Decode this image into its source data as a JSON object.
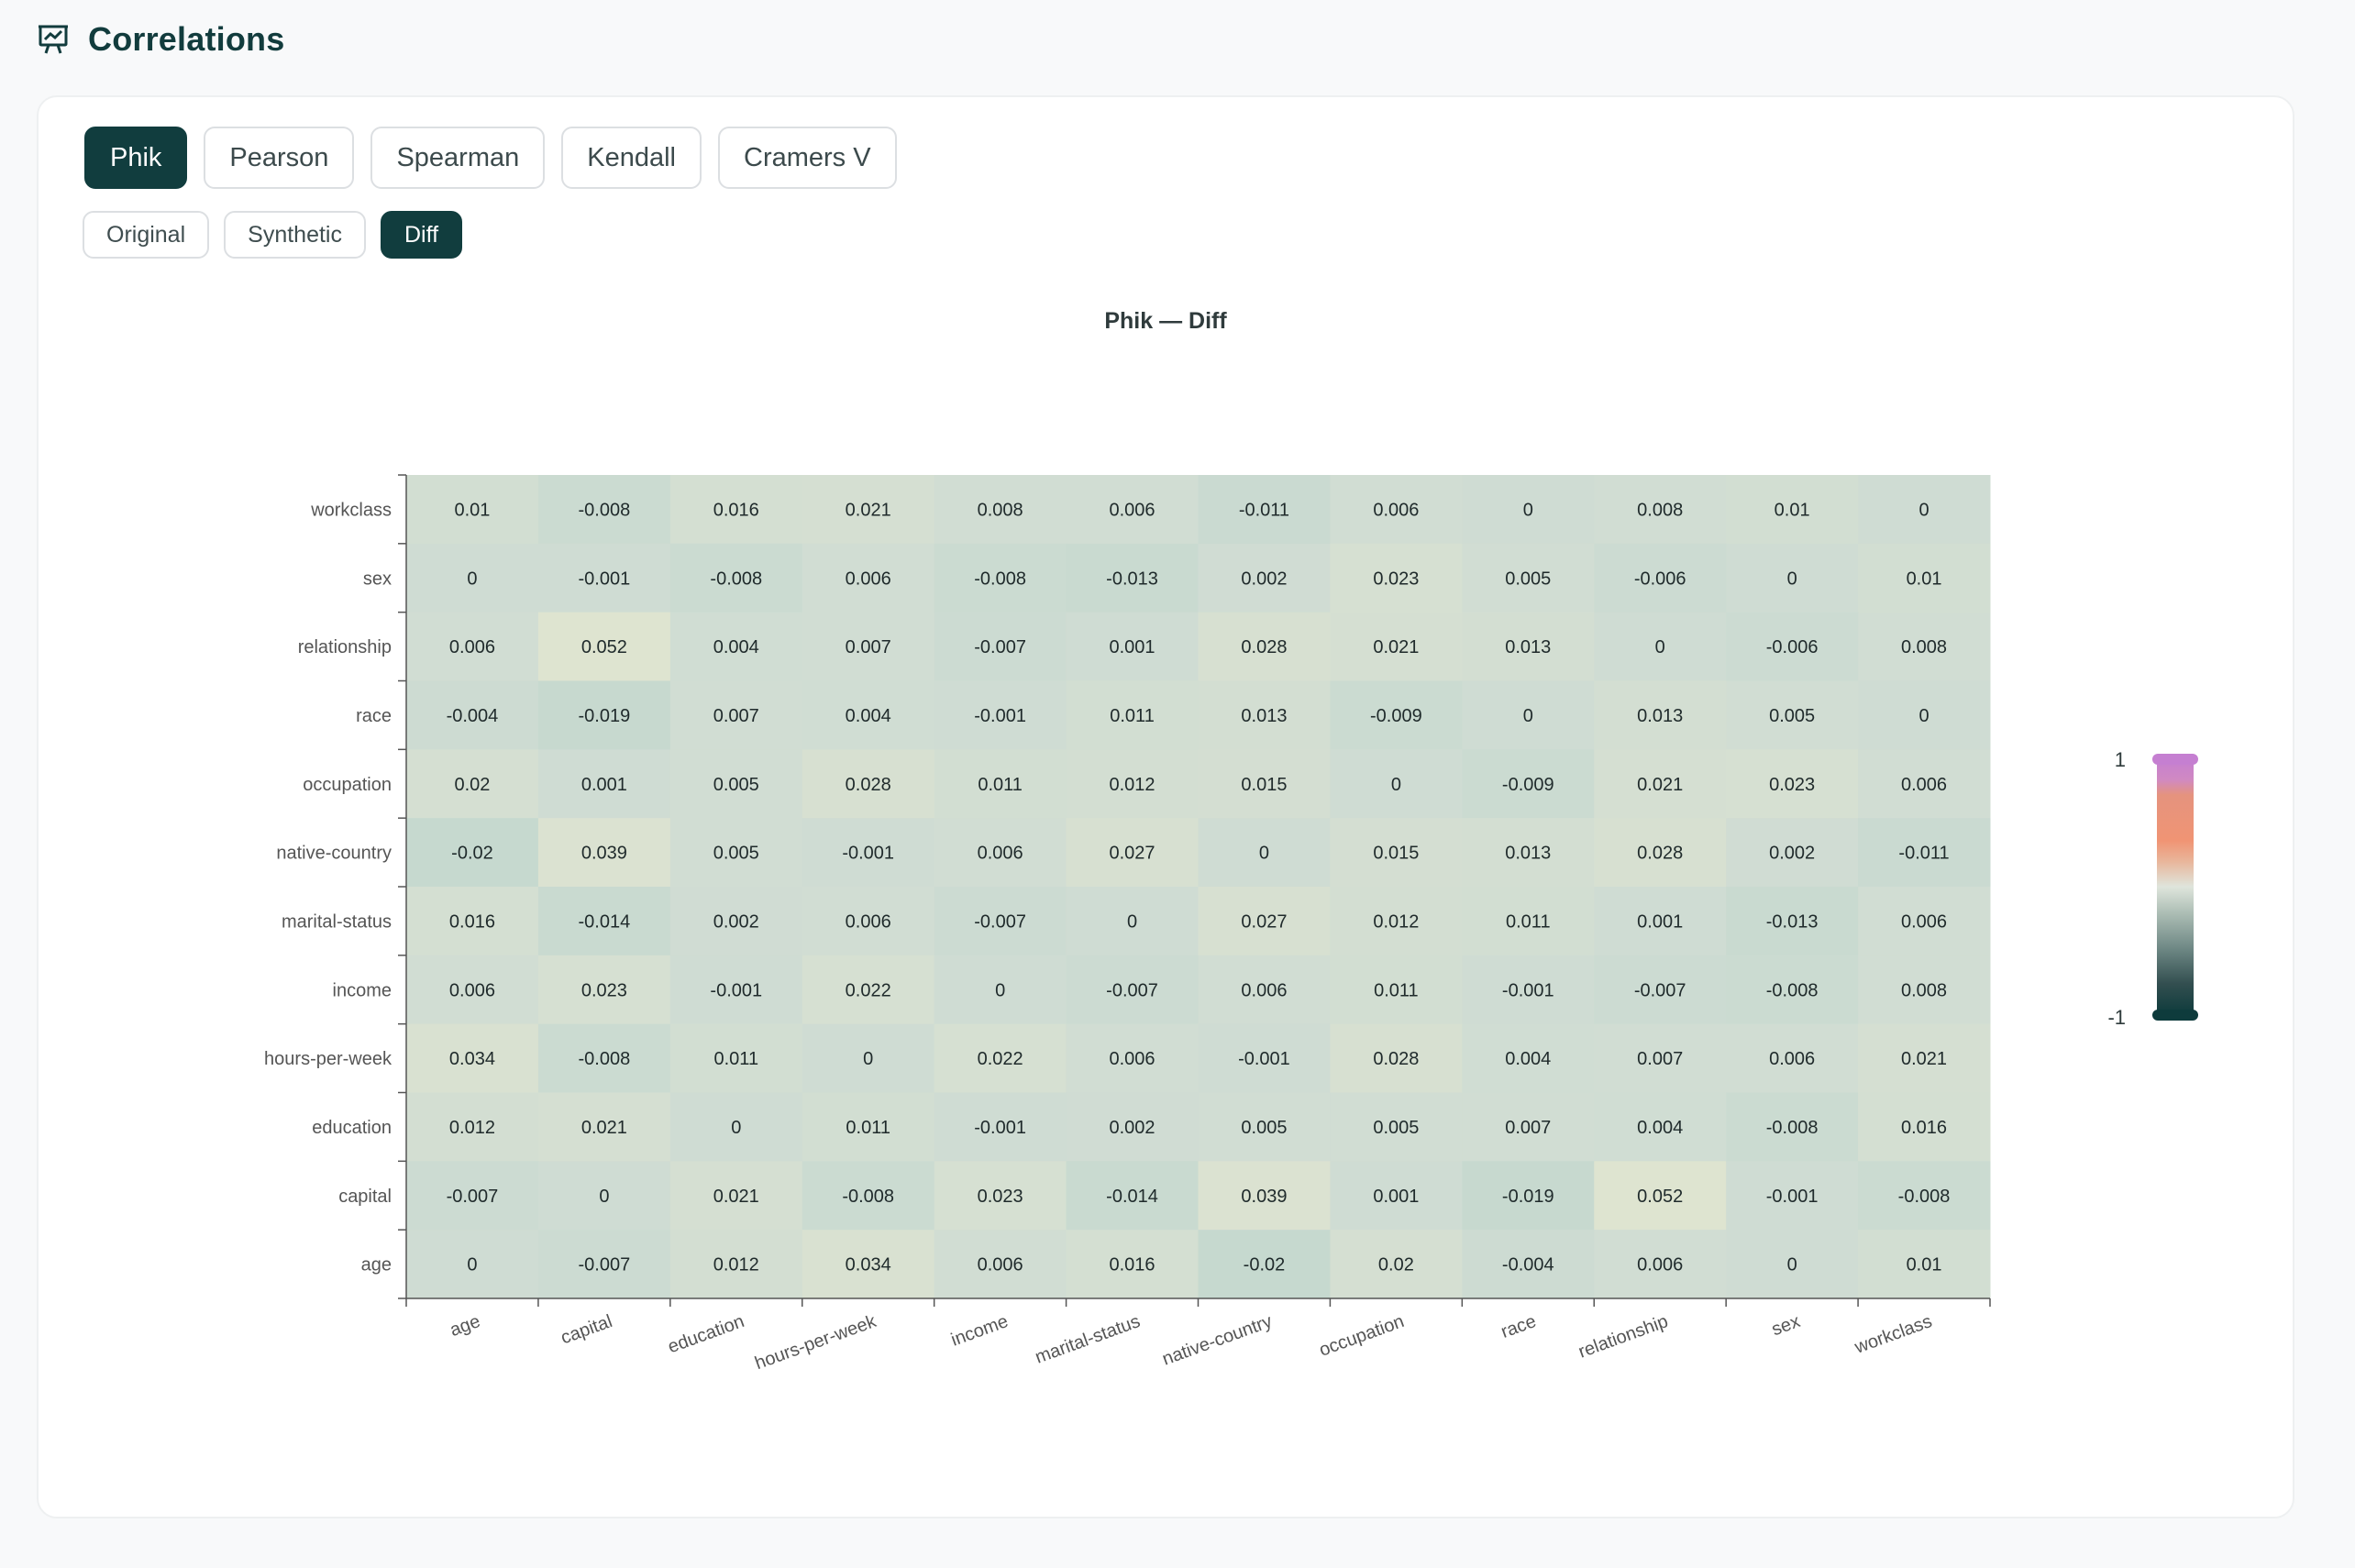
{
  "page": {
    "title": "Correlations"
  },
  "tabs": [
    {
      "label": "Phik",
      "active": true
    },
    {
      "label": "Pearson",
      "active": false
    },
    {
      "label": "Spearman",
      "active": false
    },
    {
      "label": "Kendall",
      "active": false
    },
    {
      "label": "Cramers V",
      "active": false
    }
  ],
  "subtabs": [
    {
      "label": "Original",
      "active": false
    },
    {
      "label": "Synthetic",
      "active": false
    },
    {
      "label": "Diff",
      "active": true
    }
  ],
  "chart_data": {
    "type": "heatmap",
    "title": "Phik — Diff",
    "x": [
      "age",
      "capital",
      "education",
      "hours-per-week",
      "income",
      "marital-status",
      "native-country",
      "occupation",
      "race",
      "relationship",
      "sex",
      "workclass"
    ],
    "y": [
      "workclass",
      "sex",
      "relationship",
      "race",
      "occupation",
      "native-country",
      "marital-status",
      "income",
      "hours-per-week",
      "education",
      "capital",
      "age"
    ],
    "values": [
      [
        "0.01",
        "-0.008",
        "0.016",
        "0.021",
        "0.008",
        "0.006",
        "-0.011",
        "0.006",
        "0",
        "0.008",
        "0.01",
        "0"
      ],
      [
        "0",
        "-0.001",
        "-0.008",
        "0.006",
        "-0.008",
        "-0.013",
        "0.002",
        "0.023",
        "0.005",
        "-0.006",
        "0",
        "0.01"
      ],
      [
        "0.006",
        "0.052",
        "0.004",
        "0.007",
        "-0.007",
        "0.001",
        "0.028",
        "0.021",
        "0.013",
        "0",
        "-0.006",
        "0.008"
      ],
      [
        "-0.004",
        "-0.019",
        "0.007",
        "0.004",
        "-0.001",
        "0.011",
        "0.013",
        "-0.009",
        "0",
        "0.013",
        "0.005",
        "0"
      ],
      [
        "0.02",
        "0.001",
        "0.005",
        "0.028",
        "0.011",
        "0.012",
        "0.015",
        "0",
        "-0.009",
        "0.021",
        "0.023",
        "0.006"
      ],
      [
        "-0.02",
        "0.039",
        "0.005",
        "-0.001",
        "0.006",
        "0.027",
        "0",
        "0.015",
        "0.013",
        "0.028",
        "0.002",
        "-0.011"
      ],
      [
        "0.016",
        "-0.014",
        "0.002",
        "0.006",
        "-0.007",
        "0",
        "0.027",
        "0.012",
        "0.011",
        "0.001",
        "-0.013",
        "0.006"
      ],
      [
        "0.006",
        "0.023",
        "-0.001",
        "0.022",
        "0",
        "-0.007",
        "0.006",
        "0.011",
        "-0.001",
        "-0.007",
        "-0.008",
        "0.008"
      ],
      [
        "0.034",
        "-0.008",
        "0.011",
        "0",
        "0.022",
        "0.006",
        "-0.001",
        "0.028",
        "0.004",
        "0.007",
        "0.006",
        "0.021"
      ],
      [
        "0.012",
        "0.021",
        "0",
        "0.011",
        "-0.001",
        "0.002",
        "0.005",
        "0.005",
        "0.007",
        "0.004",
        "-0.008",
        "0.016"
      ],
      [
        "-0.007",
        "0",
        "0.021",
        "-0.008",
        "0.023",
        "-0.014",
        "0.039",
        "0.001",
        "-0.019",
        "0.052",
        "-0.001",
        "-0.008"
      ],
      [
        "0",
        "-0.007",
        "0.012",
        "0.034",
        "0.006",
        "0.016",
        "-0.02",
        "0.02",
        "-0.004",
        "0.006",
        "0",
        "0.01"
      ]
    ],
    "colorbar": {
      "max_label": "1",
      "min_label": "-1",
      "range": [
        -1,
        1
      ]
    },
    "colors": {
      "neg": "#0e3b3c",
      "mid": "#cfdcd3",
      "pos": "#f09474",
      "top": "#c57fd1"
    }
  }
}
